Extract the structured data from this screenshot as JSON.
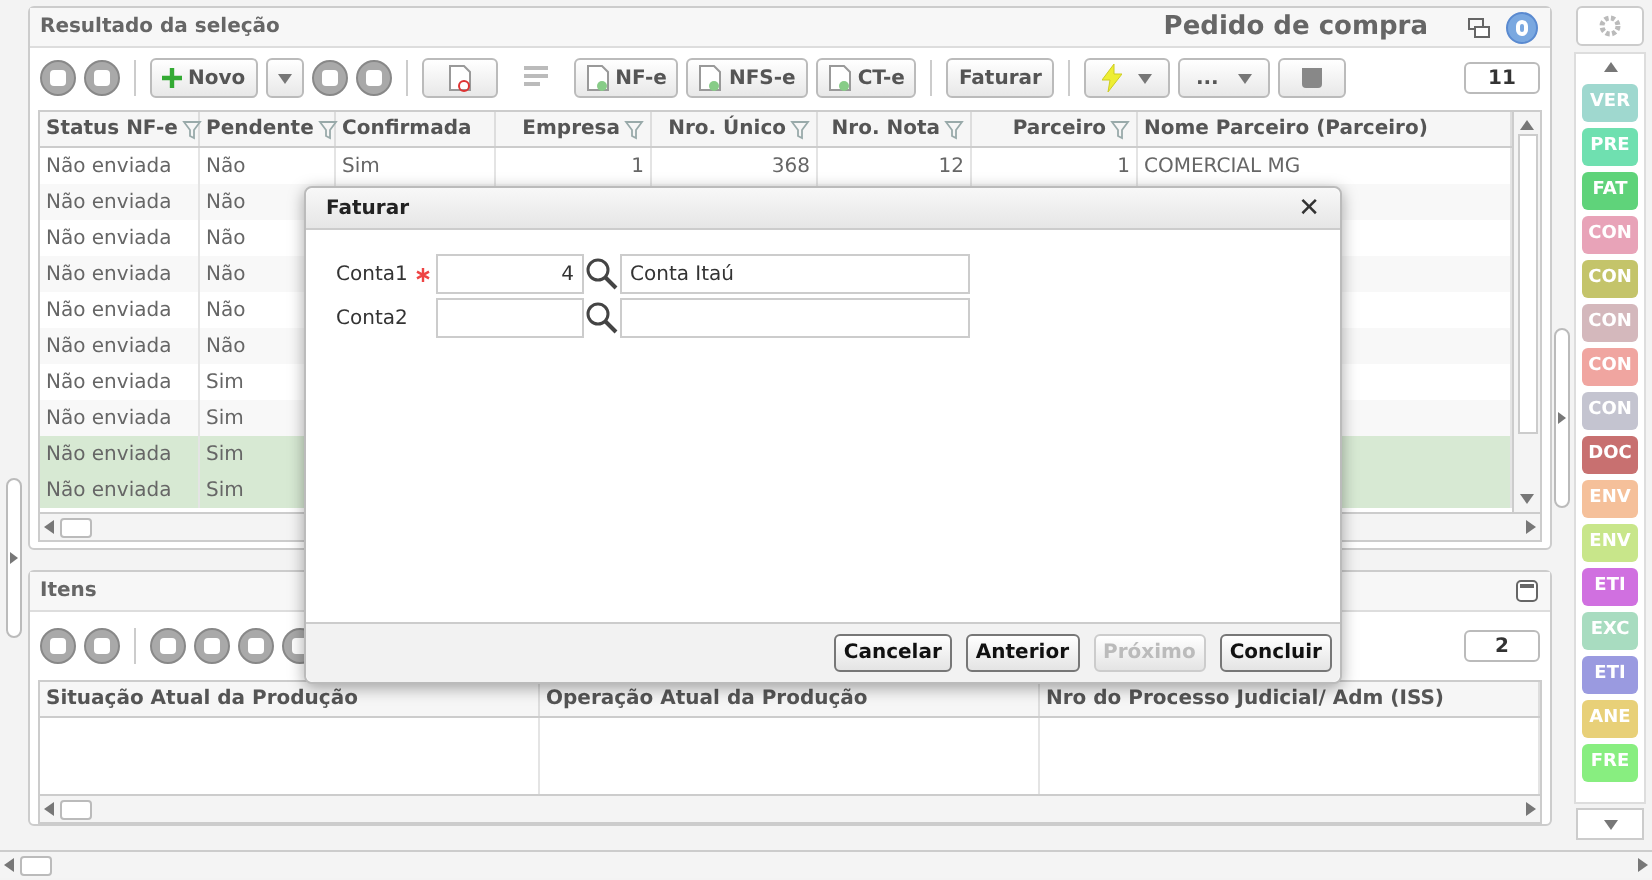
{
  "header": {
    "title": "Resultado da seleção",
    "context": "Pedido de compra"
  },
  "toolbar": {
    "new_label": "Novo",
    "doc_buttons": [
      "NF-e",
      "NFS-e",
      "CT-e"
    ],
    "faturar": "Faturar",
    "more": "...",
    "count": "11"
  },
  "table": {
    "columns": [
      {
        "label": "Status NF-e",
        "filter": true,
        "kind": "text"
      },
      {
        "label": "Pendente",
        "filter": true,
        "kind": "text"
      },
      {
        "label": "Confirmada",
        "filter": false,
        "kind": "text"
      },
      {
        "label": "Empresa",
        "filter": true,
        "kind": "number"
      },
      {
        "label": "Nro. Único",
        "filter": true,
        "kind": "number"
      },
      {
        "label": "Nro. Nota",
        "filter": true,
        "kind": "number"
      },
      {
        "label": "Parceiro",
        "filter": true,
        "kind": "number"
      },
      {
        "label": "Nome Parceiro (Parceiro)",
        "filter": false,
        "kind": "text"
      }
    ],
    "rows": [
      {
        "cells": [
          "Não enviada",
          "Não",
          "Sim",
          "1",
          "368",
          "12",
          "1",
          "COMERCIAL MG"
        ],
        "selected": false
      },
      {
        "cells": [
          "Não enviada",
          "Não"
        ],
        "selected": false
      },
      {
        "cells": [
          "Não enviada",
          "Não"
        ],
        "selected": false
      },
      {
        "cells": [
          "Não enviada",
          "Não"
        ],
        "selected": false
      },
      {
        "cells": [
          "Não enviada",
          "Não"
        ],
        "selected": false
      },
      {
        "cells": [
          "Não enviada",
          "Não"
        ],
        "selected": false
      },
      {
        "cells": [
          "Não enviada",
          "Sim"
        ],
        "selected": false
      },
      {
        "cells": [
          "Não enviada",
          "Sim"
        ],
        "selected": false
      },
      {
        "cells": [
          "Não enviada",
          "Sim"
        ],
        "selected": true
      },
      {
        "cells": [
          "Não enviada",
          "Sim"
        ],
        "selected": true
      }
    ]
  },
  "items": {
    "title": "Itens",
    "count": "2",
    "columns": [
      "Situação Atual da Produção",
      "Operação Atual da Produção",
      "Nro do Processo Judicial/ Adm (ISS)"
    ]
  },
  "dialog": {
    "title": "Faturar",
    "close": "✕",
    "fields": [
      {
        "label": "Conta1",
        "required": true,
        "code": "4",
        "name": "Conta Itaú"
      },
      {
        "label": "Conta2",
        "required": false
      }
    ],
    "buttons": [
      {
        "label": "Cancelar",
        "disabled": false
      },
      {
        "label": "Anterior",
        "disabled": false
      },
      {
        "label": "Próximo",
        "disabled": true
      },
      {
        "label": "Concluir",
        "disabled": false
      }
    ]
  },
  "sidebar": {
    "tags": [
      {
        "label": "VER",
        "color": "#9fd8cf"
      },
      {
        "label": "PRE",
        "color": "#6fe0b0"
      },
      {
        "label": "FAT",
        "color": "#5fd37a"
      },
      {
        "label": "CON",
        "color": "#e8a3b8"
      },
      {
        "label": "CON",
        "color": "#c4c46a"
      },
      {
        "label": "CON",
        "color": "#d4b8bc"
      },
      {
        "label": "CON",
        "color": "#f0a5a0"
      },
      {
        "label": "CON",
        "color": "#c4c4d0"
      },
      {
        "label": "DOC",
        "color": "#c87070"
      },
      {
        "label": "ENV",
        "color": "#f5c09a"
      },
      {
        "label": "ENV",
        "color": "#c8e68a"
      },
      {
        "label": "ETI",
        "color": "#d070e0"
      },
      {
        "label": "EXC",
        "color": "#a8dcc0"
      },
      {
        "label": "ETI",
        "color": "#9a9ae0"
      },
      {
        "label": "ANE",
        "color": "#e8d078"
      },
      {
        "label": "FRE",
        "color": "#88ee80"
      }
    ]
  }
}
